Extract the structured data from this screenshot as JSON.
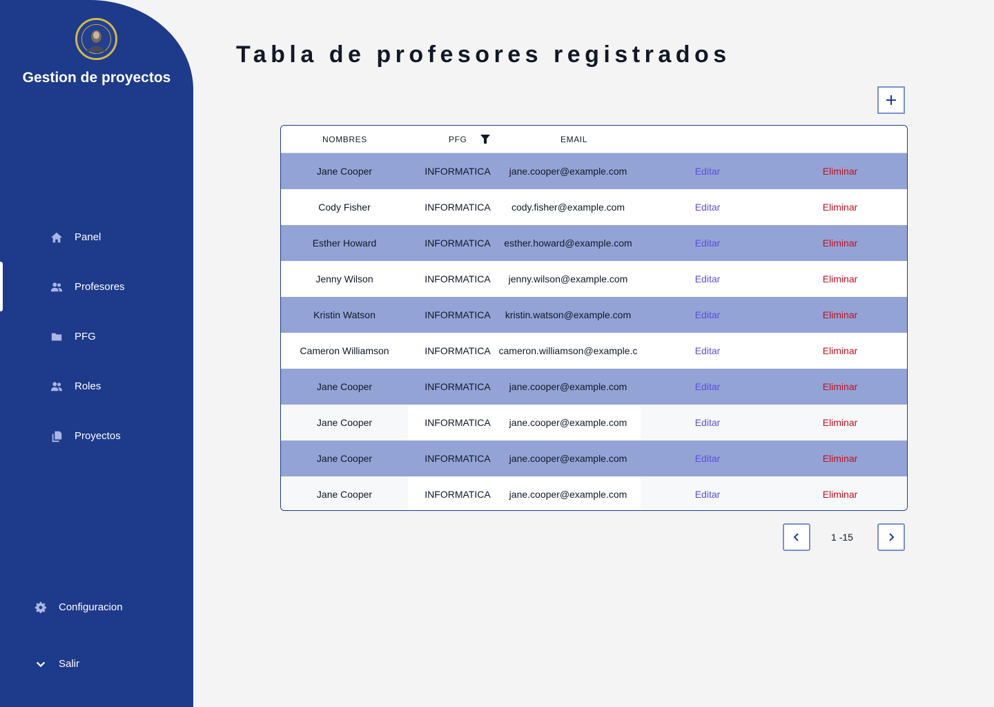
{
  "sidebar": {
    "brand": "Gestion de proyectos",
    "items": [
      {
        "label": "Panel",
        "icon": "home-icon"
      },
      {
        "label": "Profesores",
        "icon": "users-icon"
      },
      {
        "label": "PFG",
        "icon": "folder-icon"
      },
      {
        "label": "Roles",
        "icon": "users-icon"
      },
      {
        "label": "Proyectos",
        "icon": "copy-icon"
      }
    ],
    "active_item": "Profesores",
    "settings_label": "Configuracion",
    "logout_label": "Salir"
  },
  "main": {
    "title": "Tabla de profesores registrados",
    "table": {
      "columns": [
        "NOMBRES",
        "PFG",
        "EMAIL"
      ],
      "edit_label": "Editar",
      "delete_label": "Eliminar",
      "rows": [
        {
          "name": "Jane Cooper",
          "pfg": "INFORMATICA",
          "email": "jane.cooper@example.com"
        },
        {
          "name": "Cody Fisher",
          "pfg": "INFORMATICA",
          "email": "cody.fisher@example.com"
        },
        {
          "name": "Esther Howard",
          "pfg": "INFORMATICA",
          "email": "esther.howard@example.com"
        },
        {
          "name": "Jenny Wilson",
          "pfg": "INFORMATICA",
          "email": "jenny.wilson@example.com"
        },
        {
          "name": "Kristin Watson",
          "pfg": "INFORMATICA",
          "email": "kristin.watson@example.com"
        },
        {
          "name": "Cameron Williamson",
          "pfg": "INFORMATICA",
          "email": "cameron.williamson@example.c"
        },
        {
          "name": "Jane Cooper",
          "pfg": "INFORMATICA",
          "email": "jane.cooper@example.com"
        },
        {
          "name": "Jane Cooper",
          "pfg": "INFORMATICA",
          "email": "jane.cooper@example.com"
        },
        {
          "name": "Jane Cooper",
          "pfg": "INFORMATICA",
          "email": "jane.cooper@example.com"
        },
        {
          "name": "Jane Cooper",
          "pfg": "INFORMATICA",
          "email": "jane.cooper@example.com"
        }
      ]
    },
    "pagination": {
      "range": "1 -15"
    }
  },
  "colors": {
    "sidebar_bg": "#1e3a8a",
    "row_highlight": "#94a3d6",
    "row_plain": "#ffffff",
    "row_alt": "#f7f8fa",
    "edit_link": "#5b4ee0",
    "delete_link": "#c0101f"
  }
}
